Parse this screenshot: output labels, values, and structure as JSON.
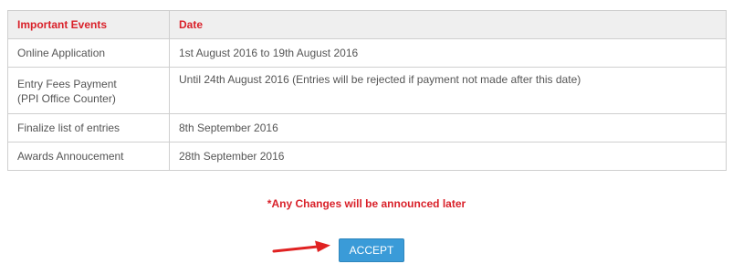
{
  "table": {
    "headers": [
      "Important Events",
      "Date"
    ],
    "rows": [
      {
        "event": "Online Application",
        "date": "1st August 2016 to 19th August 2016"
      },
      {
        "event_line1": "Entry Fees Payment",
        "event_line2": "(PPI Office Counter)",
        "date": "Until 24th August 2016 (Entries will be rejected if payment not made after this date)"
      },
      {
        "event": "Finalize list of entries",
        "date": "8th September 2016"
      },
      {
        "event": "Awards Annoucement",
        "date": "28th September 2016"
      }
    ]
  },
  "notice": "*Any Changes will be announced later",
  "accept_button": "ACCEPT",
  "colors": {
    "header_text": "#d9212a",
    "button_bg": "#3a9bd8",
    "arrow": "#e02222"
  }
}
